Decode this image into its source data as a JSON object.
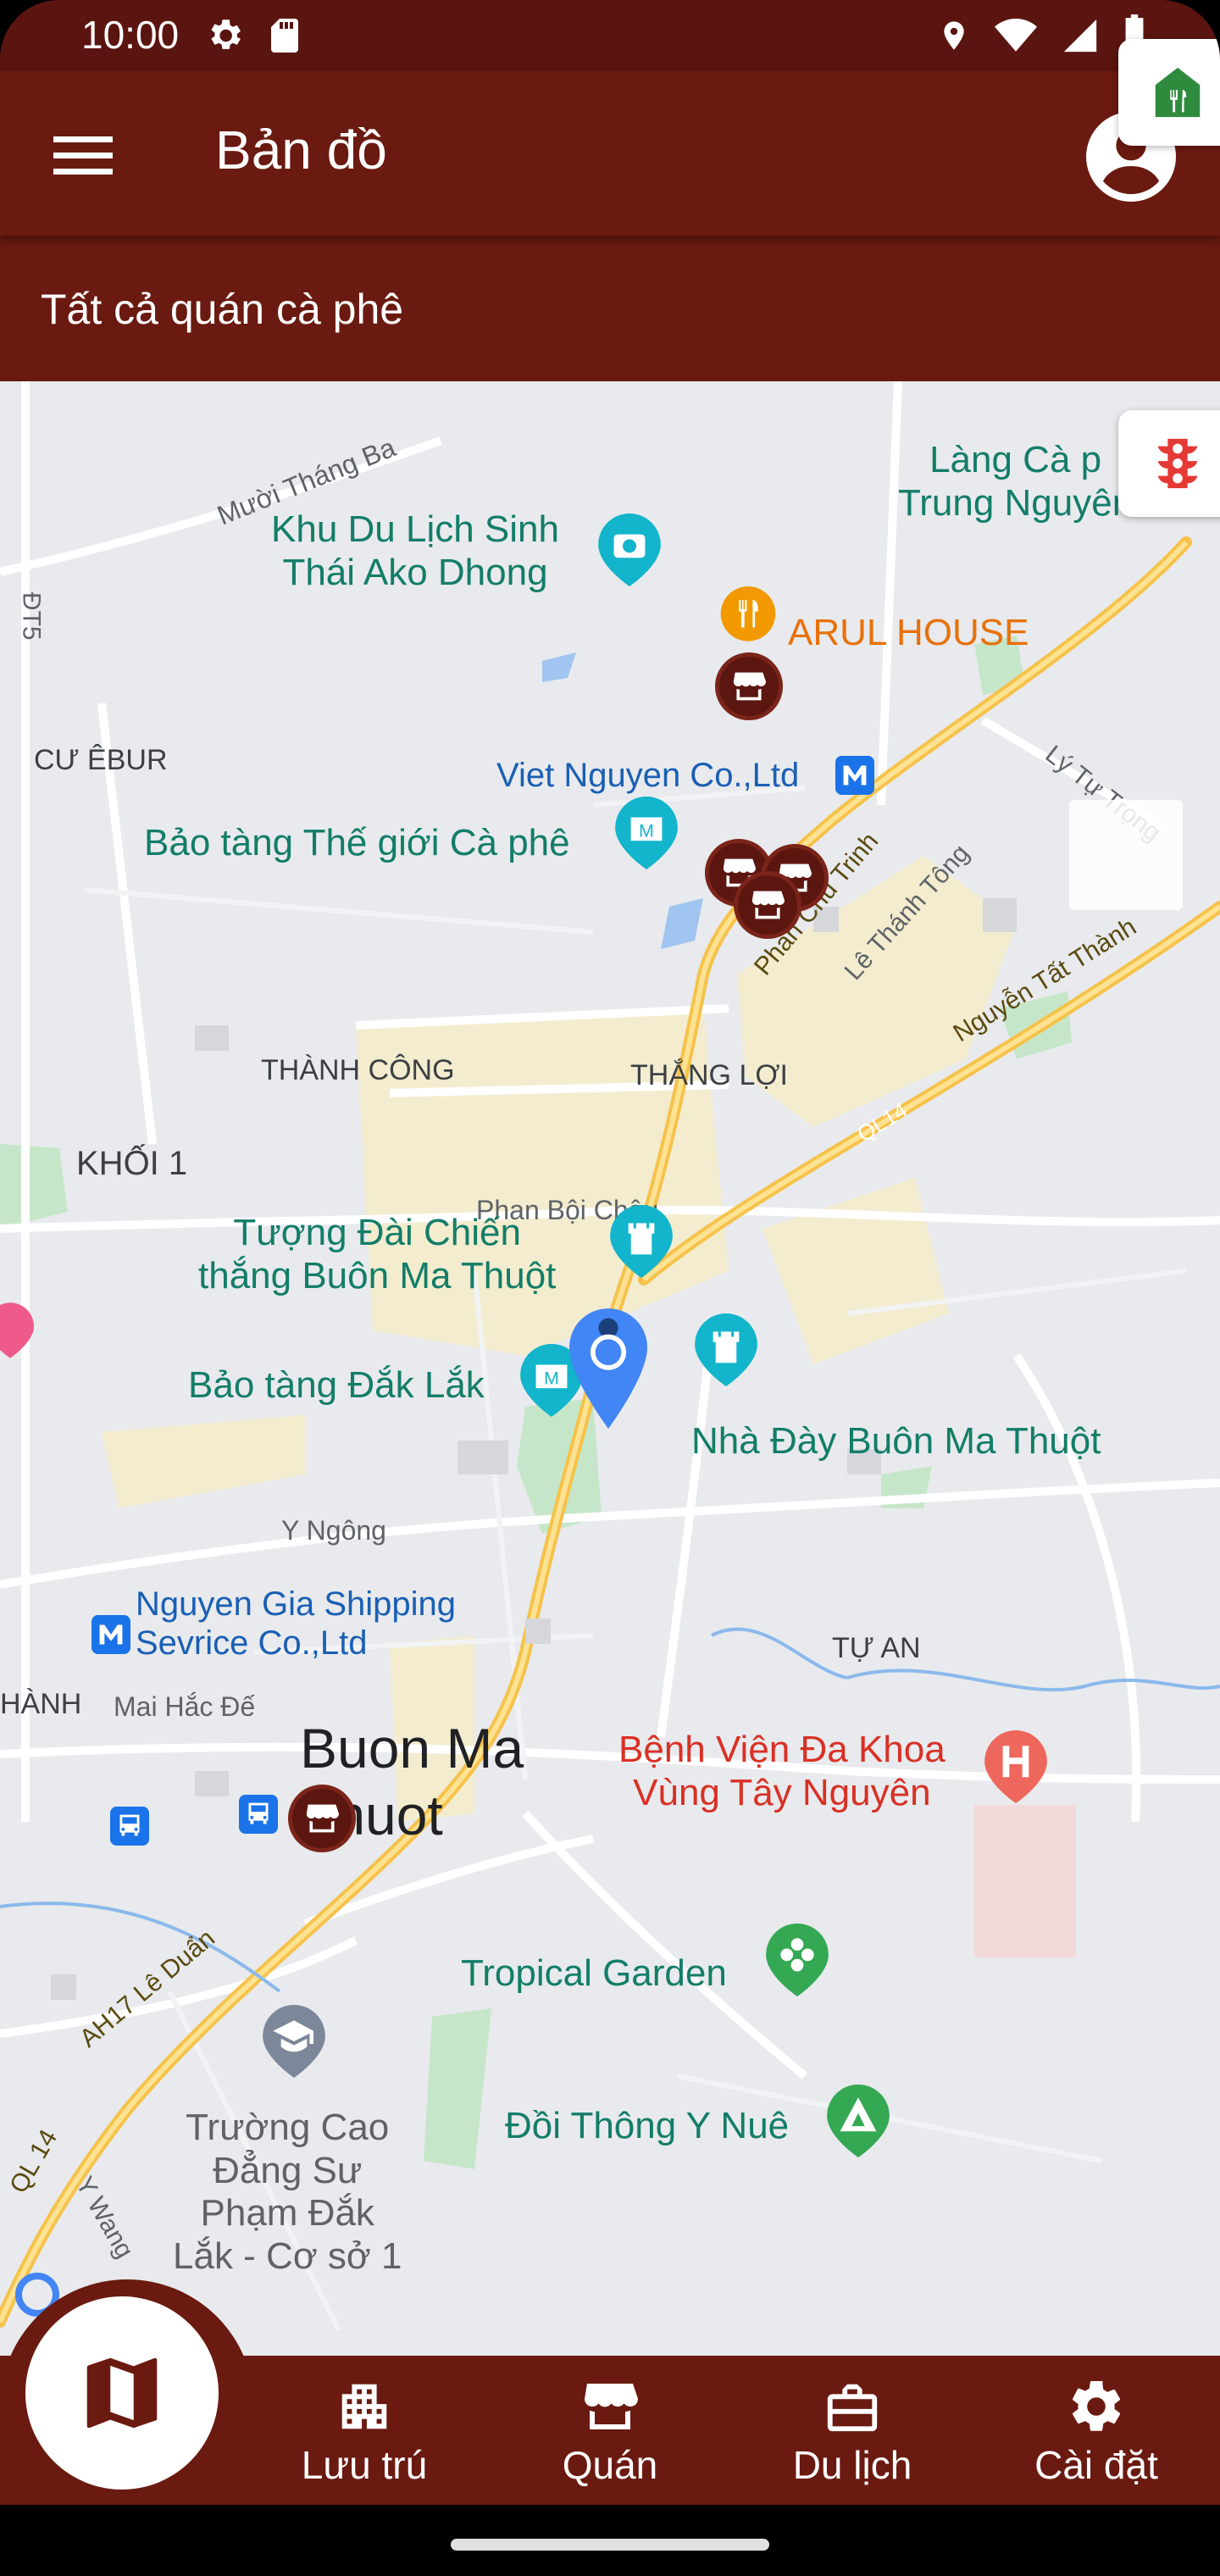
{
  "status_bar": {
    "time": "10:00",
    "left_icons": [
      "settings-icon",
      "sd-card-icon"
    ],
    "right_icons": [
      "location-icon",
      "wifi-icon",
      "signal-icon",
      "battery-icon"
    ]
  },
  "app_bar": {
    "title": "Bản đồ",
    "menu_icon": "menu-icon",
    "account_icon": "account-circle-icon"
  },
  "filter": {
    "label": "Tất cả quán cà phê",
    "chip_icon": "restaurant-icon"
  },
  "map": {
    "labels": {
      "muoi_thang_ba": "Mười Tháng Ba",
      "ako_dhong": "Khu Du Lịch Sinh\nThái Ako Dhong",
      "lang_ca_phe": "Làng Cà p\nTrung Nguyên",
      "arul_house": "ARUL HOUSE",
      "cu_ebur": "CƯ ÊBUR",
      "viet_nguyen": "Viet Nguyen Co.,Ltd",
      "bao_tang_the_gioi": "Bảo tàng Thế giới Cà phê",
      "ly_tu_trong": "Lý Tự Trọng",
      "phan_chu_trinh": "Phan Chu Trinh",
      "le_thanh_tong": "Lê Thánh Tông",
      "nguyen_tat_thanh": "Nguyễn Tất Thành",
      "ql14_a": "QL14",
      "thanh_cong": "THÀNH CÔNG",
      "thang_loi": "THẮNG LỢI",
      "khoi_1": "KHỐI 1",
      "phan_boi_chau": "Phan Bội Châu",
      "tuong_dai": "Tượng Đài Chiến\nthắng Buôn Ma Thuột",
      "bao_tang_dak_lak": "Bảo tàng Đắk Lắk",
      "nha_day": "Nhà Đày Buôn Ma Thuột",
      "y_ngong": "Y Ngông",
      "nguyen_gia": "Nguyen Gia Shipping\nSevrice Co.,Ltd",
      "tu_an": "TỰ AN",
      "hanh": "HÀNH",
      "mai_hac_de": "Mai Hắc Đế",
      "buon_ma_thuot": "Buon Ma\nThuot",
      "benh_vien": "Bệnh Viện Đa Khoa\nVùng Tây Nguyên",
      "tropical_garden": "Tropical Garden",
      "ah17_le_duan": "AH17 Lê Duẩn",
      "truong_cao_dang": "Trường Cao\nĐẳng Sư\nPhạm Đắk\nLắk - Cơ sở 1",
      "doi_thong": "Đồi Thông Y Nuê",
      "ql14_b": "QL 14",
      "y_wang": "Y Wang",
      "dt5": "ĐT5"
    },
    "traffic_icon": "traffic-light-icon",
    "zoom_in": "+",
    "zoom_out": "−"
  },
  "bottom_nav": {
    "map_icon": "map-icon",
    "items": [
      {
        "label": "Lưu trú",
        "icon": "apartment-icon"
      },
      {
        "label": "Quán",
        "icon": "storefront-icon"
      },
      {
        "label": "Du lịch",
        "icon": "briefcase-icon"
      },
      {
        "label": "Cài đặt",
        "icon": "settings-icon"
      }
    ]
  },
  "colors": {
    "brand": "#6a1a10",
    "status_bar": "#5a1510",
    "map_bg": "#e8eaed",
    "poi_green": "#137d68",
    "shop_marker": "#5c1610"
  }
}
